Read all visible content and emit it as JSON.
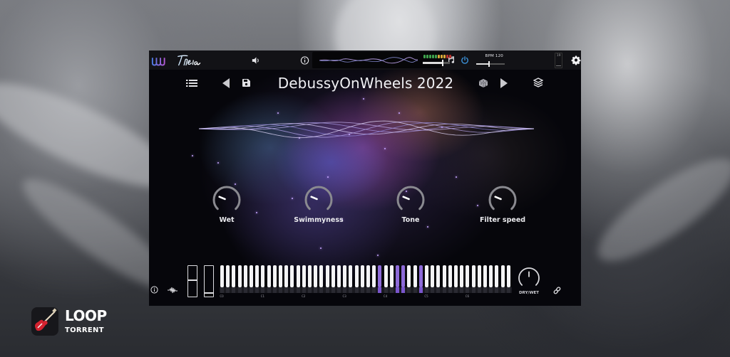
{
  "app": {
    "name": "Theia",
    "logo_text": "Theia"
  },
  "topbar": {
    "icons": [
      "waveform-logo-icon",
      "volume-icon",
      "info-icon",
      "music-note-icon",
      "power-icon",
      "settings-gear-icon"
    ],
    "bpm_label": "BPM 120",
    "bpm_value": 120,
    "bpm_slider_fraction": 0.45,
    "output_slider_fraction": 0.75,
    "mini_box_text": "19",
    "meter_leds": [
      "#3fa34d",
      "#3fa34d",
      "#3fa34d",
      "#3fa34d",
      "#3fa34d",
      "#d8a93a",
      "#d8a93a",
      "#d8a93a",
      "#b8322e",
      "#b8322e"
    ],
    "accent_color": "#3b8fd6"
  },
  "preset": {
    "name": "DebussyOnWheels 2022",
    "icons": [
      "preset-list-icon",
      "previous-preset-icon",
      "save-icon",
      "randomize-dice-icon",
      "next-preset-icon",
      "layers-icon"
    ]
  },
  "knobs": [
    {
      "label": "Wet",
      "value": 0.25
    },
    {
      "label": "Swimmyness",
      "value": 0.25
    },
    {
      "label": "Tone",
      "value": 0.25
    },
    {
      "label": "Filter speed",
      "value": 0.25
    }
  ],
  "faders": [
    {
      "name": "fader-1",
      "value": 0.55
    },
    {
      "name": "fader-2",
      "value": 0.1
    }
  ],
  "keyboard": {
    "octave_labels": [
      "C0",
      "C1",
      "C2",
      "C3",
      "C4",
      "C5",
      "C6"
    ],
    "white_keys_per_octave": 7,
    "octaves": 7,
    "highlight_color": "#8d6ad8",
    "active_keys": [
      27,
      30,
      31,
      34
    ]
  },
  "drywet": {
    "label": "DRY/WET",
    "value": 0.5
  },
  "watermark": {
    "line1": "LOOP",
    "line2": "TORRENT"
  }
}
